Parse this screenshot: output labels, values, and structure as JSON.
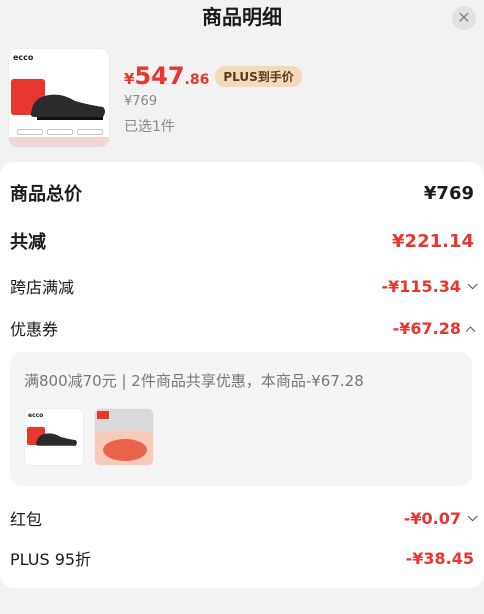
{
  "header": {
    "title": "商品明细",
    "close_icon": "close-icon"
  },
  "product": {
    "brand": "ecco",
    "price_yen": "¥",
    "price_int": "547",
    "price_dec": ".86",
    "plus_badge": "PLUS到手价",
    "original_price": "¥769",
    "selected": "已选1件"
  },
  "summary": {
    "total_label": "商品总价",
    "total_value": "¥769",
    "discount_label": "共减",
    "discount_value": "¥221.14",
    "cross_store_label": "跨店满减",
    "cross_store_value": "-¥115.34",
    "coupon_label": "优惠券",
    "coupon_value": "-¥67.28",
    "coupon_desc": "满800减70元 | 2件商品共享优惠，本商品-¥67.28",
    "red_packet_label": "红包",
    "red_packet_value": "-¥0.07",
    "plus_label": "PLUS 95折",
    "plus_value": "-¥38.45"
  },
  "colors": {
    "accent": "#e8352e",
    "plus_badge_bg": "#f4d9b8"
  }
}
